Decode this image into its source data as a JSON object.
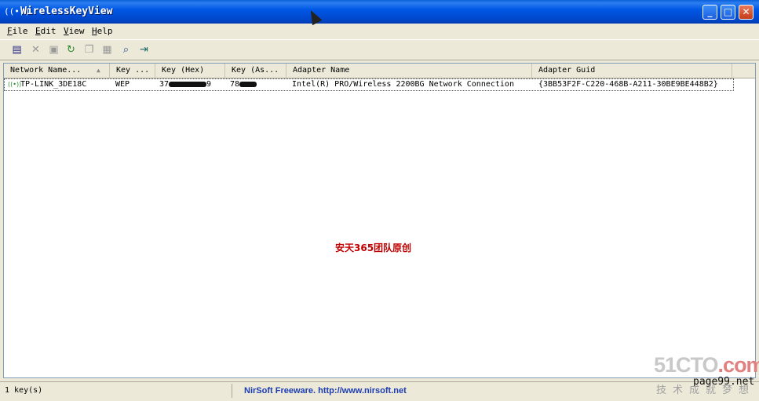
{
  "window": {
    "title": "WirelessKeyView",
    "app_icon": "wifi-icon",
    "controls": [
      "minimize",
      "maximize",
      "close"
    ]
  },
  "menu": {
    "file": {
      "u": "F",
      "rest": "ile"
    },
    "edit": {
      "u": "E",
      "rest": "dit"
    },
    "view": {
      "u": "V",
      "rest": "iew"
    },
    "help": {
      "u": "H",
      "rest": "elp"
    }
  },
  "toolbar": {
    "icons": [
      "properties-icon",
      "delete-icon",
      "save-icon",
      "refresh-icon",
      "copy-icon",
      "html-report-icon",
      "find-icon",
      "exit-icon"
    ]
  },
  "list": {
    "columns": [
      "Network Name...",
      "Key ...",
      "Key (Hex)",
      "Key (As...",
      "Adapter Name",
      "Adapter Guid"
    ],
    "sort_indicator": "▲",
    "rows": [
      {
        "network_name": "TP-LINK_3DE18C",
        "key_type": "WEP",
        "key_hex_prefix": "37",
        "key_hex_suffix": "9",
        "key_ascii_prefix": "78",
        "adapter_name": "Intel(R) PRO/Wireless 2200BG Network Connection",
        "adapter_guid": "{3BB53F2F-C220-468B-A211-30BE9BE448B2}"
      }
    ]
  },
  "watermark": "安天365团队原创",
  "status": {
    "count": "1 key(s)",
    "link": "NirSoft Freeware.  http://www.nirsoft.net"
  },
  "overlay_logo": {
    "main_a": "51CTO",
    "main_b": ".com",
    "sub": "page99.net",
    "cn": "技术成就梦想"
  },
  "colors": {
    "titlebar": "#0058e6",
    "watermark": "#c00000",
    "link": "#1c3cb4"
  }
}
